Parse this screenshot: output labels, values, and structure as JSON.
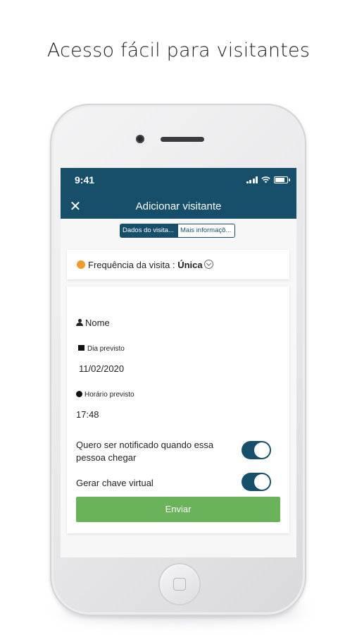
{
  "headline": "Acesso fácil para visitantes",
  "status_bar": {
    "time": "9:41"
  },
  "nav": {
    "title": "Adicionar visitante",
    "close_icon": "close-icon"
  },
  "segments": [
    {
      "label": "Dados do visita...",
      "active": true
    },
    {
      "label": "Mais informaçõ...",
      "active": false
    }
  ],
  "frequency": {
    "label": "Frequência da visita : ",
    "value": "Única"
  },
  "form": {
    "name_label": "Nome",
    "date_label": "Dia previsto",
    "date_value": "11/02/2020",
    "time_label": "Horário previsto",
    "time_value": "17:48",
    "notify_label": "Quero ser notificado quando essa pessoa chegar",
    "notify_on": true,
    "key_label": "Gerar chave virtual",
    "key_on": true,
    "submit_label": "Enviar"
  },
  "colors": {
    "primary": "#174f6b",
    "accent": "#f39a2b",
    "success": "#6ab35a"
  }
}
